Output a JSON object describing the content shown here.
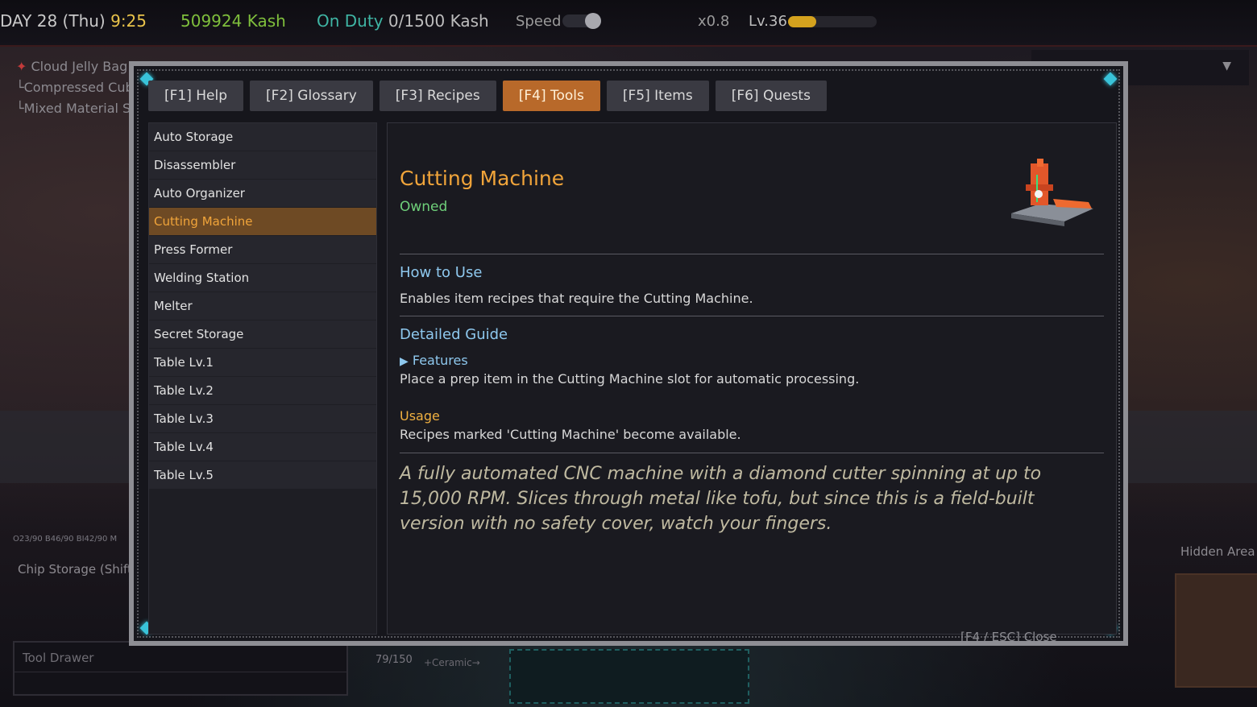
{
  "topbar": {
    "day": "DAY 28 (Thu)",
    "time": "9:25",
    "kash": "509924 Kash",
    "duty_label": "On Duty",
    "duty_value": "0/1500 Kash",
    "speed_label": "Speed",
    "multiplier": "x0.8",
    "level": "Lv.36",
    "level_progress": 0.32
  },
  "background": {
    "list": [
      "Cloud Jelly Bag ← C",
      "└Compressed Cub",
      "└Mixed Material S"
    ],
    "stats": "O23/90  B46/90  BI42/90  M",
    "chip_storage": "Chip Storage (Shift)",
    "hidden_area": "Hidden Area",
    "tool_drawer": "Tool Drawer",
    "count": "79/150",
    "ceramic": "+Ceramic→"
  },
  "tabs": [
    {
      "label": "[F1] Help",
      "active": false
    },
    {
      "label": "[F2] Glossary",
      "active": false
    },
    {
      "label": "[F3] Recipes",
      "active": false
    },
    {
      "label": "[F4] Tools",
      "active": true
    },
    {
      "label": "[F5] Items",
      "active": false
    },
    {
      "label": "[F6] Quests",
      "active": false
    }
  ],
  "sidebar": {
    "items": [
      {
        "label": "Auto Storage"
      },
      {
        "label": "Disassembler"
      },
      {
        "label": "Auto Organizer"
      },
      {
        "label": "Cutting Machine",
        "active": true
      },
      {
        "label": "Press Former"
      },
      {
        "label": "Welding Station"
      },
      {
        "label": "Melter"
      },
      {
        "label": "Secret Storage"
      },
      {
        "label": "Table Lv.1"
      },
      {
        "label": "Table Lv.2"
      },
      {
        "label": "Table Lv.3"
      },
      {
        "label": "Table Lv.4"
      },
      {
        "label": "Table Lv.5"
      }
    ]
  },
  "detail": {
    "title": "Cutting Machine",
    "status": "Owned",
    "how_to_use_heading": "How to Use",
    "how_to_use_text": "Enables item recipes that require the Cutting Machine.",
    "guide_heading": "Detailed Guide",
    "features_label": "Features",
    "features_text": "Place a prep item in the Cutting Machine slot for automatic processing.",
    "usage_label": "Usage",
    "usage_text": "Recipes marked 'Cutting Machine' become available.",
    "flavor": "A fully automated CNC machine with a diamond cutter spinning at up to 15,000 RPM. Slices through metal like tofu, but since this is a field-built version with no safety cover, watch your fingers."
  },
  "close_hint": "[F4 / ESC] Close",
  "colors": {
    "accent_orange": "#f0a43a",
    "active_tab": "#b8692a",
    "heading_blue": "#8ec8ee",
    "owned_green": "#6fd07a",
    "frame_cyan": "#39c3d9"
  }
}
